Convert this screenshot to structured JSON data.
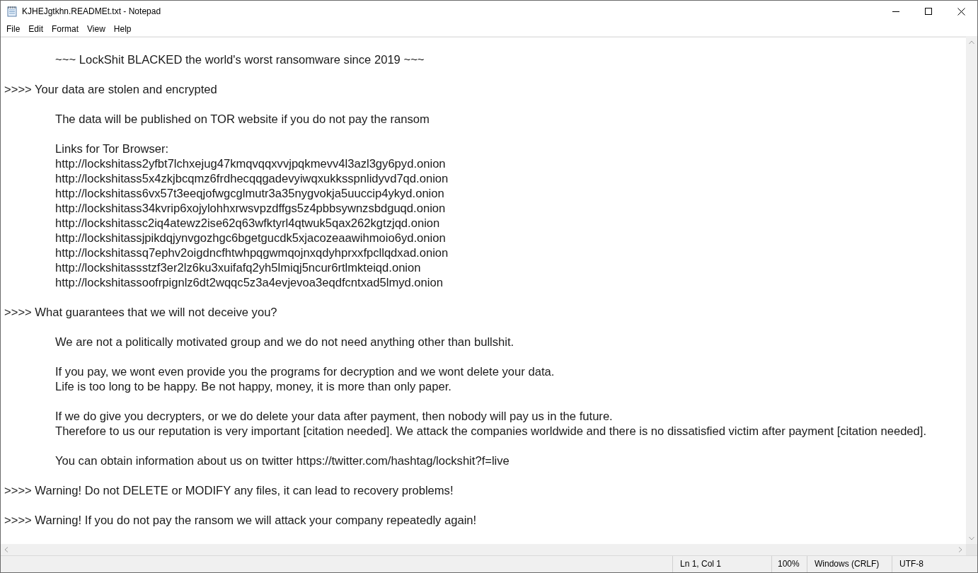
{
  "window": {
    "title": "KJHEJgtkhn.READMEt.txt - Notepad"
  },
  "menu": [
    "File",
    "Edit",
    "Format",
    "View",
    "Help"
  ],
  "document": [
    {
      "lines": [
        "\t~~~ LockShit BLACKED the world's worst ransomware since 2019 ~~~"
      ]
    },
    {
      "lines": [
        ">>>> Your data are stolen and encrypted"
      ]
    },
    {
      "lines": [
        "\tThe data will be published on TOR website if you do not pay the ransom"
      ]
    },
    {
      "lines": [
        "\tLinks for Tor Browser:",
        "\thttp://lockshitass2yfbt7lchxejug47kmqvqqxvvjpqkmevv4l3azl3gy6pyd.onion",
        "\thttp://lockshitass5x4zkjbcqmz6frdhecqqgadevyiwqxukksspnlidyvd7qd.onion",
        "\thttp://lockshitass6vx57t3eeqjofwgcglmutr3a35nygvokja5uuccip4ykyd.onion",
        "\thttp://lockshitass34kvrip6xojylohhxrwsvpzdffgs5z4pbbsywnzsbdguqd.onion",
        "\thttp://lockshitassc2iq4atewz2ise62q63wfktyrl4qtwuk5qax262kgtzjqd.onion",
        "\thttp://lockshitassjpikdqjynvgozhgc6bgetgucdk5xjacozeaawihmoio6yd.onion",
        "\thttp://lockshitassq7ephv2oigdncfhtwhpqgwmqojnxqdyhprxxfpcllqdxad.onion",
        "\thttp://lockshitassstzf3er2lz6ku3xuifafq2yh5lmiqj5ncur6rtlmkteiqd.onion",
        "\thttp://lockshitassoofrpignlz6dt2wqqc5z3a4evjevoa3eqdfcntxad5lmyd.onion"
      ]
    },
    {
      "lines": [
        ">>>> What guarantees that we will not deceive you?"
      ]
    },
    {
      "lines": [
        "\tWe are not a politically motivated group and we do not need anything other than bullshit."
      ]
    },
    {
      "lines": [
        "\tIf you pay, we wont even provide you the programs for decryption and we wont delete your data.",
        "\tLife is too long to be happy. Be not happy, money, it is more than only paper."
      ]
    },
    {
      "lines": [
        "\tIf we do give you decrypters, or we do delete your data after payment, then nobody will pay us in the future.",
        "\tTherefore to us our reputation is very important [citation needed]. We attack the companies worldwide and there is no dissatisfied victim after payment [citation needed]."
      ]
    },
    {
      "lines": [
        "\tYou can obtain information about us on twitter https://twitter.com/hashtag/lockshit?f=live"
      ]
    },
    {
      "lines": [
        ">>>> Warning! Do not DELETE or MODIFY any files, it can lead to recovery problems!"
      ]
    },
    {
      "lines": [
        ">>>> Warning! If you do not pay the ransom we will attack your company repeatedly again!"
      ]
    }
  ],
  "status_bar": {
    "position": "Ln 1, Col 1",
    "zoom": "100%",
    "line_endings": "Windows (CRLF)",
    "encoding": "UTF-8"
  }
}
